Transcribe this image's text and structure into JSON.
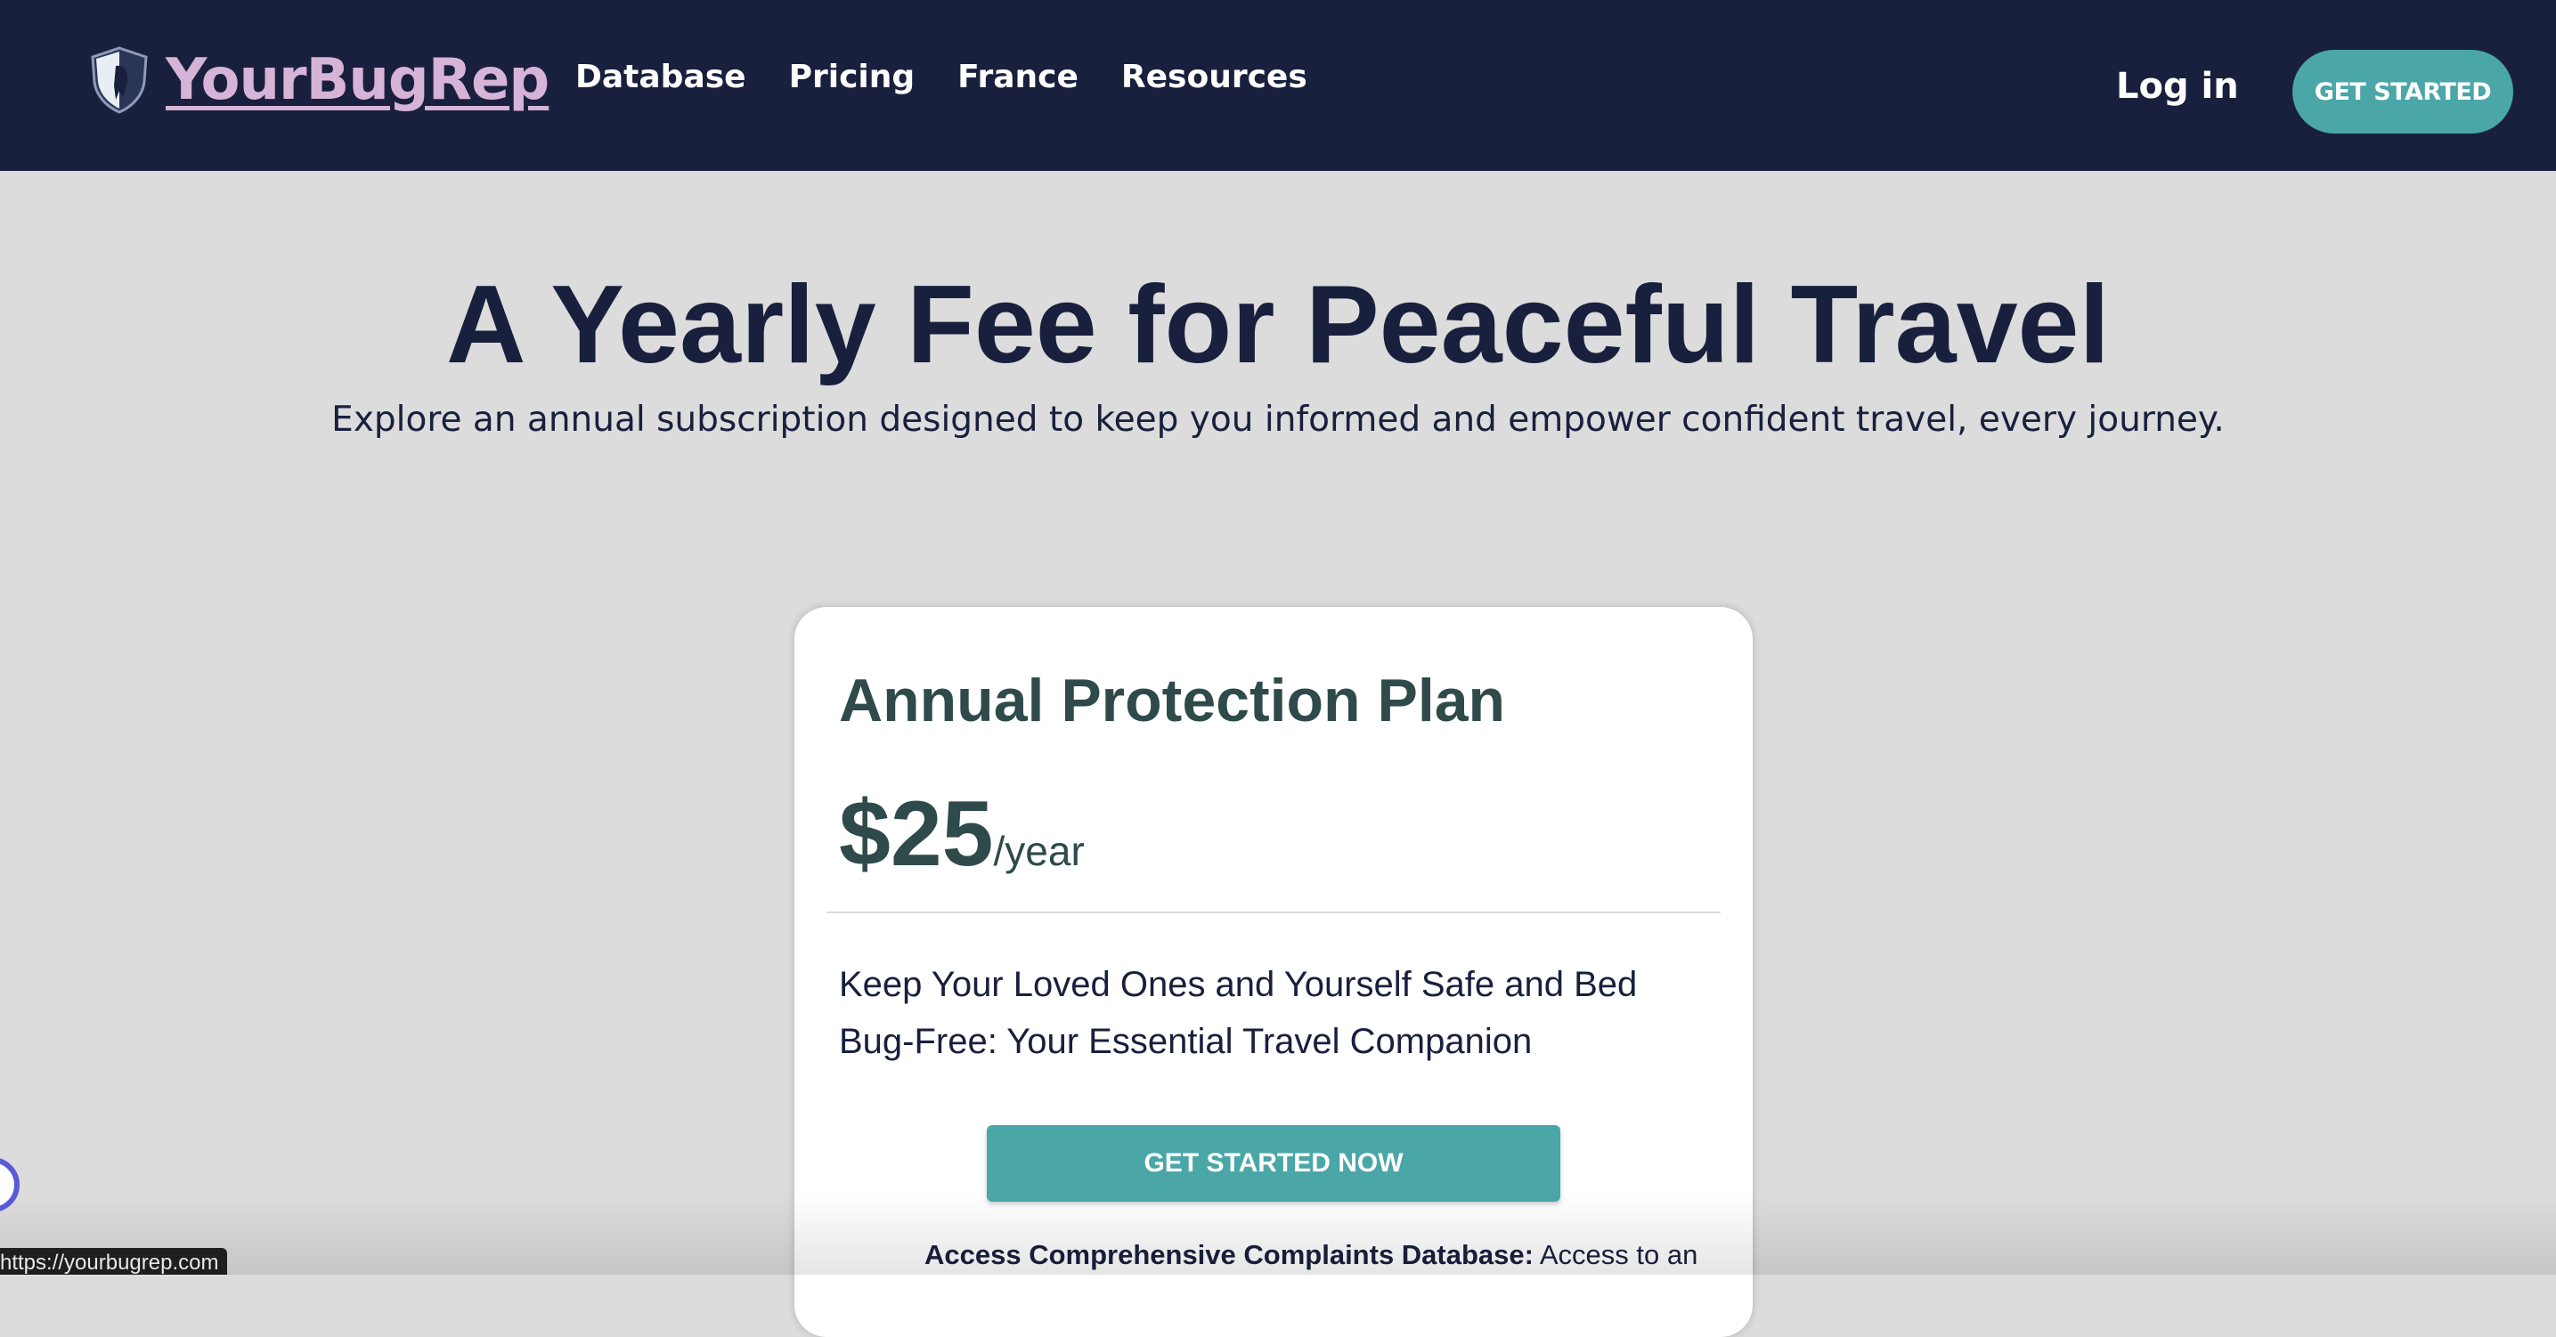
{
  "nav": {
    "brand": "YourBugRep",
    "links": [
      "Database",
      "Pricing",
      "France",
      "Resources"
    ],
    "login": "Log in",
    "cta": "GET STARTED"
  },
  "hero": {
    "title": "A Yearly Fee for Peaceful Travel",
    "subtitle": "Explore an annual subscription designed to keep you informed and empower confident travel, every journey."
  },
  "plan": {
    "name": "Annual Protection Plan",
    "price": "$25",
    "period": "/year",
    "tagline": "Keep Your Loved Ones and Yourself Safe and Bed Bug-Free: Your Essential Travel Companion",
    "cta": "GET STARTED NOW",
    "feature": {
      "title": "Access Comprehensive Complaints Database:",
      "text": " Access to an"
    }
  },
  "browser": {
    "status_url": "https://yourbugrep.com"
  },
  "colors": {
    "navbar": "#19203d",
    "brand": "#d6b4d7",
    "accent": "#4aa6a7",
    "background": "#dcdcdc",
    "card_text": "#2f4a4a"
  },
  "icons": {
    "logo": "shield-icon",
    "widget": "chat-widget-icon"
  }
}
